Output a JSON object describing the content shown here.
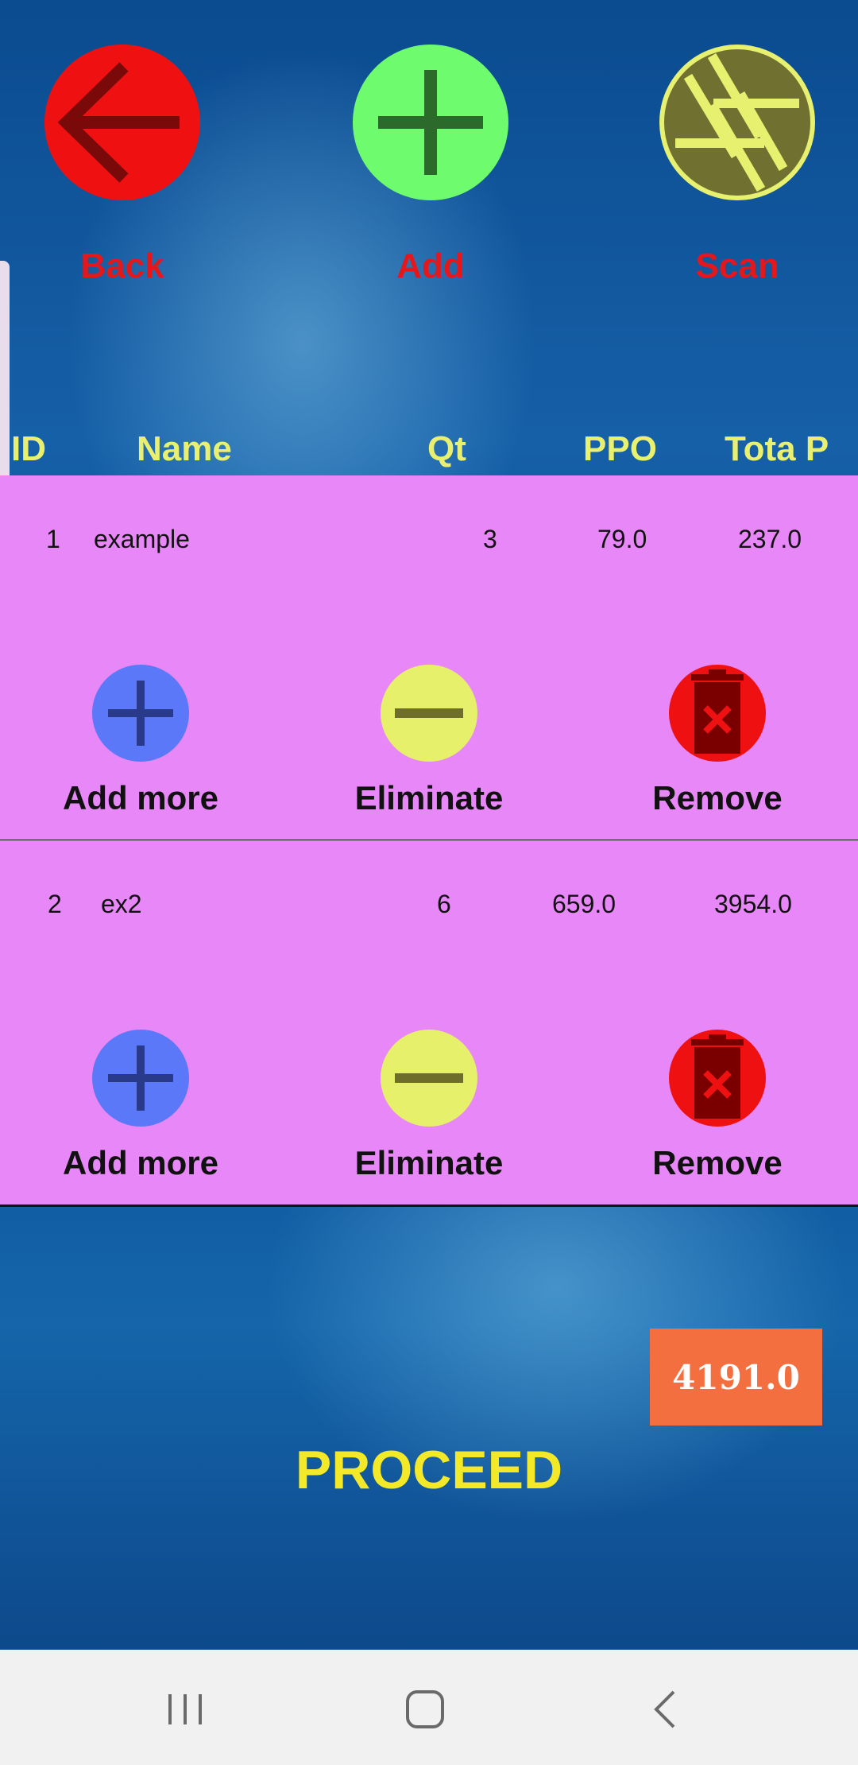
{
  "top_actions": {
    "back_label": "Back",
    "add_label": "Add",
    "scan_label": "Scan"
  },
  "table": {
    "columns": [
      "ID",
      "Name",
      "Qt",
      "PPO",
      "Tota P"
    ],
    "rows": [
      {
        "id": "1",
        "name": "example",
        "qt": "3",
        "ppo": "79.0",
        "total": "237.0"
      },
      {
        "id": "2",
        "name": "ex2",
        "qt": "6",
        "ppo": "659.0",
        "total": "3954.0"
      }
    ]
  },
  "row_actions": {
    "add_more_label": "Add more",
    "eliminate_label": "Eliminate",
    "remove_label": "Remove"
  },
  "summary": {
    "total": "4191.0",
    "proceed_label": "PROCEED"
  },
  "colors": {
    "back_red": "#ef1111",
    "add_green": "#6efc6e",
    "scan_olive": "#707030",
    "row_pink": "#e887f8",
    "label_red": "#e5171a",
    "header_yellow": "#e9f06f",
    "total_orange": "#f46f3f",
    "proceed_yellow": "#f4e928"
  },
  "icons": {
    "back": "arrow-left-icon",
    "add": "plus-icon",
    "scan": "camera-shutter-icon",
    "add_more": "plus-icon",
    "eliminate": "minus-icon",
    "remove": "trash-icon"
  }
}
